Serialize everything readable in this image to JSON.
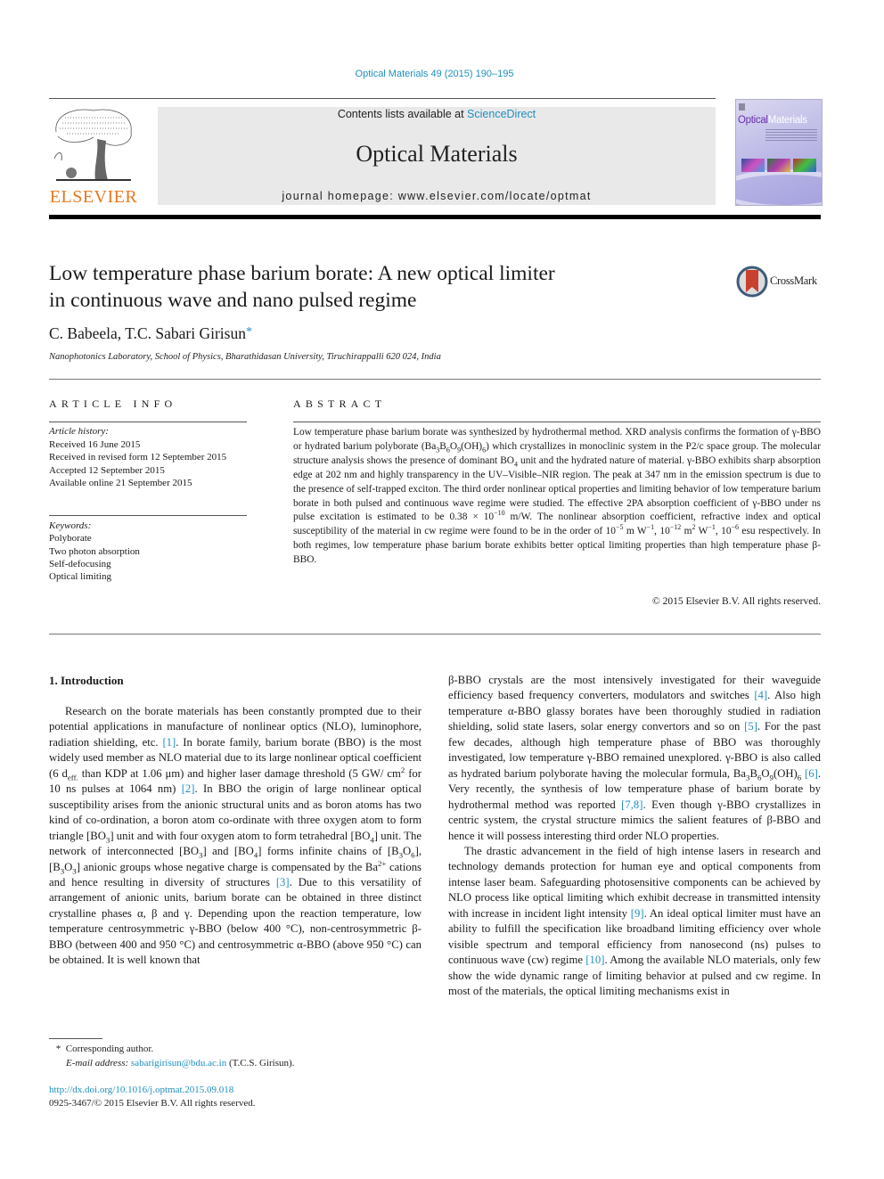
{
  "header": {
    "citation": "Optical Materials 49 (2015) 190–195",
    "publisher_logo_text": "ELSEVIER",
    "contents_prefix": "Contents lists available at ",
    "contents_link": "ScienceDirect",
    "journal_title": "Optical Materials",
    "homepage": "journal homepage: www.elsevier.com/locate/optmat",
    "cover": {
      "title_dark": "Optical",
      "title_light": "Materials"
    }
  },
  "article": {
    "title_line1": "Low temperature phase barium borate: A new optical limiter",
    "title_line2": "in continuous wave and nano pulsed regime",
    "crossmark_label": "CrossMark",
    "authors": "C. Babeela, T.C. Sabari Girisun",
    "author_marker": "*",
    "affiliation": "Nanophotonics Laboratory, School of Physics, Bharathidasan University, Tiruchirappalli 620 024, India"
  },
  "article_info": {
    "heading": "ARTICLE INFO",
    "history_label": "Article history:",
    "history": [
      "Received 16 June 2015",
      "Received in revised form 12 September 2015",
      "Accepted 12 September 2015",
      "Available online 21 September 2015"
    ],
    "keywords_label": "Keywords:",
    "keywords": [
      "Polyborate",
      "Two photon absorption",
      "Self-defocusing",
      "Optical limiting"
    ]
  },
  "abstract": {
    "heading": "ABSTRACT",
    "s1": "Low temperature phase barium borate was synthesized by hydrothermal method. XRD analysis confirms the formation of γ-BBO or hydrated barium polyborate (Ba",
    "s2": "O",
    "s3": "(OH)",
    "s4": ") which crystallizes in monoclinic system in the P2/c space group. The molecular structure analysis shows the presence of dominant BO",
    "s5": " unit and the hydrated nature of material. γ-BBO exhibits sharp absorption edge at 202 nm and highly transparency in the UV–Visible–NIR region. The peak at 347 nm in the emission spectrum is due to the presence of self-trapped exciton. The third order nonlinear optical properties and limiting behavior of low temperature barium borate in both pulsed and continuous wave regime were studied. The effective 2PA absorption coefficient of γ-BBO under ns pulse excitation is estimated to be 0.38 × 10",
    "s6": " m/W. The nonlinear absorption coefficient, refractive index and optical susceptibility of the material in cw regime were found to be in the order of 10",
    "s7": " m W",
    "s8": ", 10",
    "s9": " m",
    "s10": " W",
    "s11": ", 10",
    "s12": " esu respectively. In both regimes, low temperature phase barium borate exhibits better optical limiting properties than high temperature phase β-BBO.",
    "sub3": "3",
    "subB6": "B",
    "sub6": "6",
    "sub9": "9",
    "sub6b": "6",
    "sub4": "4",
    "exp_m10": "−10",
    "exp_m5": "−5",
    "exp_m1": "−1",
    "exp_m12": "−12",
    "exp_2": "2",
    "exp_m1b": "−1",
    "exp_m6": "−6",
    "copyright": "© 2015 Elsevier B.V. All rights reserved."
  },
  "introduction": {
    "heading": "1. Introduction",
    "p1_a": "Research on the borate materials has been constantly prompted due to their potential applications in manufacture of nonlinear optics (NLO), luminophore, radiation shielding, etc. ",
    "ref1": "[1]",
    "p1_b": ". In borate family, barium borate (BBO) is the most widely used member as NLO material due to its large nonlinear optical coefficient (6 d",
    "deff_sub": "eff.",
    "p1_c": " than KDP at 1.06 μm) and higher laser damage threshold (5 GW/ cm",
    "cm_sup": "2",
    "p1_d": " for 10 ns pulses at 1064 nm) ",
    "ref2": "[2]",
    "p1_e": ". In BBO the origin of large nonlinear optical susceptibility arises from the anionic structural units and as boron atoms has two kind of co-ordination, a boron atom co-ordinate with three oxygen atom to form triangle [BO",
    "p1_f": "] unit and with four oxygen atom to form tetrahedral [BO",
    "p1_g": "] unit. The network of interconnected [BO",
    "p1_h": "] and [BO",
    "p1_i": "] forms infinite chains of [B",
    "p1_j": "O",
    "p1_k": "], [B",
    "p1_l": "O",
    "p1_m": "] anionic groups whose negative charge is compensated by the Ba",
    "ba_sup": "2+",
    "p1_n": " cations and hence resulting in diversity of structures ",
    "ref3": "[3]",
    "p1_o": ". Due to this versatility of arrangement of anionic units, barium borate can be obtained in three distinct crystalline phases α, β and γ. Depending upon the reaction temperature, low temperature centrosymmetric γ-BBO (below 400 °C), non-centrosymmetric β-BBO (between 400 and 950 °C) and centrosymmetric α-BBO (above 950 °C) can be obtained. It is well known that",
    "n3": "3",
    "n4": "4",
    "n6": "6",
    "r1_a": "β-BBO crystals are the most intensively investigated for their waveguide efficiency based frequency converters, modulators and switches ",
    "ref4": "[4]",
    "r1_b": ". Also high temperature α-BBO glassy borates have been thoroughly studied in radiation shielding, solid state lasers, solar energy convertors and so on ",
    "ref5": "[5]",
    "r1_c": ". For the past few decades, although high temperature phase of BBO was thoroughly investigated, low temperature γ-BBO remained unexplored. γ-BBO is also called as hydrated barium polyborate having the molecular formula, Ba",
    "r1_d": "B",
    "r1_e": "O",
    "r1_f": "(OH)",
    "r1_g": " ",
    "ref6": "[6]",
    "r1_h": ". Very recently, the synthesis of low temperature phase of barium borate by hydrothermal method was reported ",
    "ref78": "[7,8]",
    "r1_i": ". Even though γ-BBO crystallizes in centric system, the crystal structure mimics the salient features of β-BBO and hence it will possess interesting third order NLO properties.",
    "n9": "9",
    "r2_a": "The drastic advancement in the field of high intense lasers in research and technology demands protection for human eye and optical components from intense laser beam. Safeguarding photosensitive components can be achieved by NLO process like optical limiting which exhibit decrease in transmitted intensity with increase in incident light intensity ",
    "ref9": "[9]",
    "r2_b": ". An ideal optical limiter must have an ability to fulfill the specification like broadband limiting efficiency over whole visible spectrum and temporal efficiency from nanosecond (ns) pulses to continuous wave (cw) regime ",
    "ref10": "[10]",
    "r2_c": ". Among the available NLO materials, only few show the wide dynamic range of limiting behavior at pulsed and cw regime. In most of the materials, the optical limiting mechanisms exist in"
  },
  "footnote": {
    "marker": "*",
    "corresponding": "Corresponding author.",
    "email_label": "E-mail address:",
    "email": "sabarigirisun@bdu.ac.in",
    "email_suffix": " (T.C.S. Girisun).",
    "doi": "http://dx.doi.org/10.1016/j.optmat.2015.09.018",
    "issn": "0925-3467/© 2015 Elsevier B.V. All rights reserved."
  },
  "colors": {
    "link": "#1f8fbf",
    "elsevier_orange": "#e8781e",
    "cover_purple": "#6a2fb0",
    "masthead_bg": "#e9e9e9"
  }
}
